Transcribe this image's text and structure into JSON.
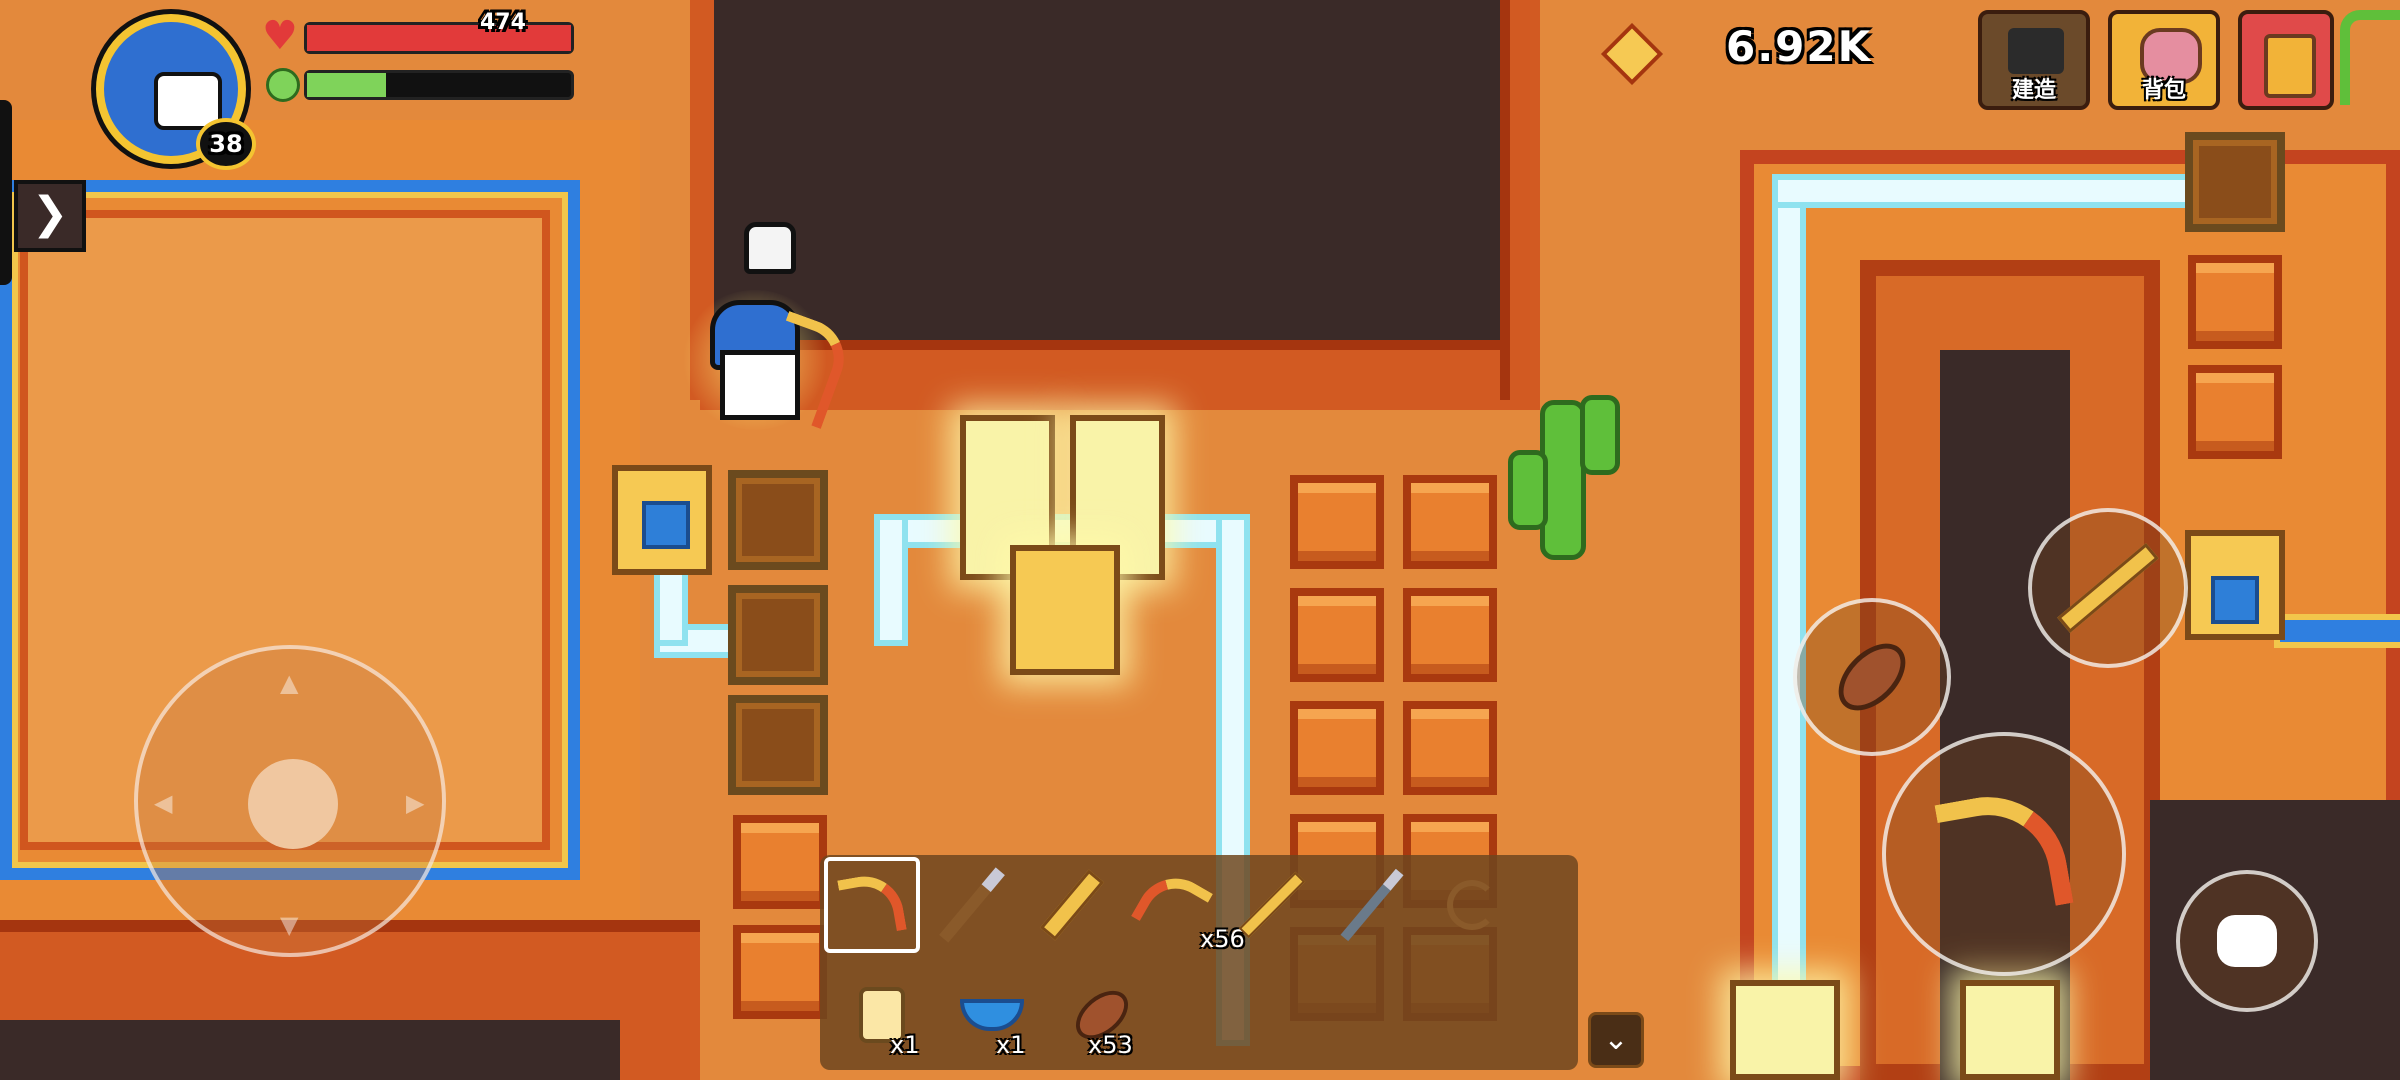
{
  "player": {
    "level": "38",
    "hp_text": "474",
    "hp_fraction": 1.0,
    "energy_fraction": 0.3
  },
  "currency": {
    "amount": "6.92K"
  },
  "top_buttons": {
    "build_label": "建造",
    "backpack_label": "背包"
  },
  "hotbar": {
    "tools": [
      {
        "name": "pickaxe",
        "qty": ""
      },
      {
        "name": "shovel",
        "qty": ""
      },
      {
        "name": "sword",
        "qty": ""
      },
      {
        "name": "crossbow",
        "qty": "x56"
      },
      {
        "name": "spear",
        "qty": ""
      },
      {
        "name": "hammer",
        "qty": ""
      },
      {
        "name": "fishing-rod",
        "qty": ""
      }
    ],
    "items": [
      {
        "name": "jar",
        "qty": "x1"
      },
      {
        "name": "food-bowl",
        "qty": "x1"
      },
      {
        "name": "roasted-fish",
        "qty": "x53"
      }
    ]
  },
  "colors": {
    "hp": "#e23a3a",
    "energy": "#7fd35a",
    "sand": "#eb9a4a",
    "wall": "#c4441f",
    "void": "#3a2a28"
  }
}
